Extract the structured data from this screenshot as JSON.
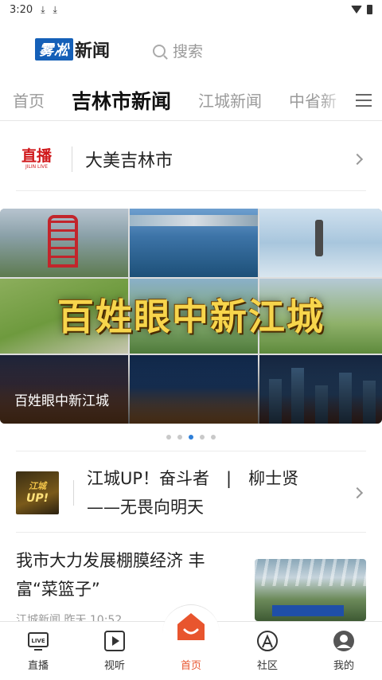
{
  "status_bar": {
    "time": "3:20",
    "download_icons": [
      "download-icon",
      "download-icon"
    ]
  },
  "header": {
    "logo_badge": "雾凇",
    "logo_word": "新闻",
    "search_placeholder": "搜索"
  },
  "tabs": [
    {
      "label": "首页",
      "active": false
    },
    {
      "label": "吉林市新闻",
      "active": true
    },
    {
      "label": "江城新闻",
      "active": false
    },
    {
      "label": "中省新",
      "active": false
    }
  ],
  "live": {
    "logo_text": "直播",
    "logo_subtext": "JILIN LIVE",
    "title": "大美吉林市"
  },
  "banner": {
    "headline": "百姓眼中新江城",
    "caption": "百姓眼中新江城",
    "dots": 5,
    "active_dot": 2
  },
  "feature": {
    "logo_line1": "江城",
    "logo_line2": "UP!",
    "title": "江城UP！奋斗者　|　柳士贤——无畏向明天"
  },
  "article": {
    "title": "我市大力发展棚膜经济 丰富“菜篮子”",
    "meta": "江城新闻 昨天 10:52"
  },
  "bottom_nav": [
    {
      "label": "直播",
      "icon": "live-tv-icon",
      "active": false
    },
    {
      "label": "视听",
      "icon": "play-icon",
      "active": false
    },
    {
      "label": "首页",
      "icon": "home-smile-icon",
      "active": true
    },
    {
      "label": "社区",
      "icon": "community-icon",
      "active": false
    },
    {
      "label": "我的",
      "icon": "user-icon",
      "active": false
    }
  ],
  "colors": {
    "accent": "#e8552e",
    "brand": "#1560b8",
    "live_red": "#d0181b",
    "dot_active": "#2e7fd8"
  }
}
